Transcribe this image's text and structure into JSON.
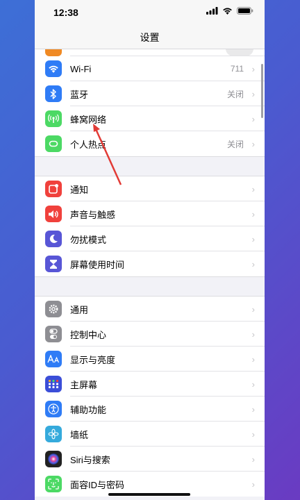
{
  "status": {
    "time": "12:38"
  },
  "nav": {
    "title": "设置"
  },
  "groups": [
    [
      {
        "label": "Wi-Fi",
        "value": "711",
        "icon": "wifi-icon",
        "color": "#2f7cf6"
      },
      {
        "label": "蓝牙",
        "value": "关闭",
        "icon": "bluetooth-icon",
        "color": "#2f7cf6"
      },
      {
        "label": "蜂窝网络",
        "value": "",
        "icon": "antenna-icon",
        "color": "#4cd964"
      },
      {
        "label": "个人热点",
        "value": "关闭",
        "icon": "hotspot-icon",
        "color": "#4cd964"
      }
    ],
    [
      {
        "label": "通知",
        "icon": "notification-icon",
        "color": "#f0413c"
      },
      {
        "label": "声音与触感",
        "icon": "speaker-icon",
        "color": "#f0413c"
      },
      {
        "label": "勿扰模式",
        "icon": "moon-icon",
        "color": "#5856d6"
      },
      {
        "label": "屏幕使用时间",
        "icon": "hourglass-icon",
        "color": "#5856d6"
      }
    ],
    [
      {
        "label": "通用",
        "icon": "gear-icon",
        "color": "#8e8e93"
      },
      {
        "label": "控制中心",
        "icon": "toggles-icon",
        "color": "#8e8e93"
      },
      {
        "label": "显示与亮度",
        "icon": "aa-icon",
        "color": "#2f7cf6"
      },
      {
        "label": "主屏幕",
        "icon": "grid-icon",
        "color": "#2f7cf6"
      },
      {
        "label": "辅助功能",
        "icon": "accessibility-icon",
        "color": "#2f7cf6"
      },
      {
        "label": "墙纸",
        "icon": "flower-icon",
        "color": "#35aadc"
      },
      {
        "label": "Siri与搜索",
        "icon": "siri-icon",
        "color": "#222222"
      },
      {
        "label": "面容ID与密码",
        "icon": "faceid-icon",
        "color": "#4cd964"
      }
    ]
  ]
}
